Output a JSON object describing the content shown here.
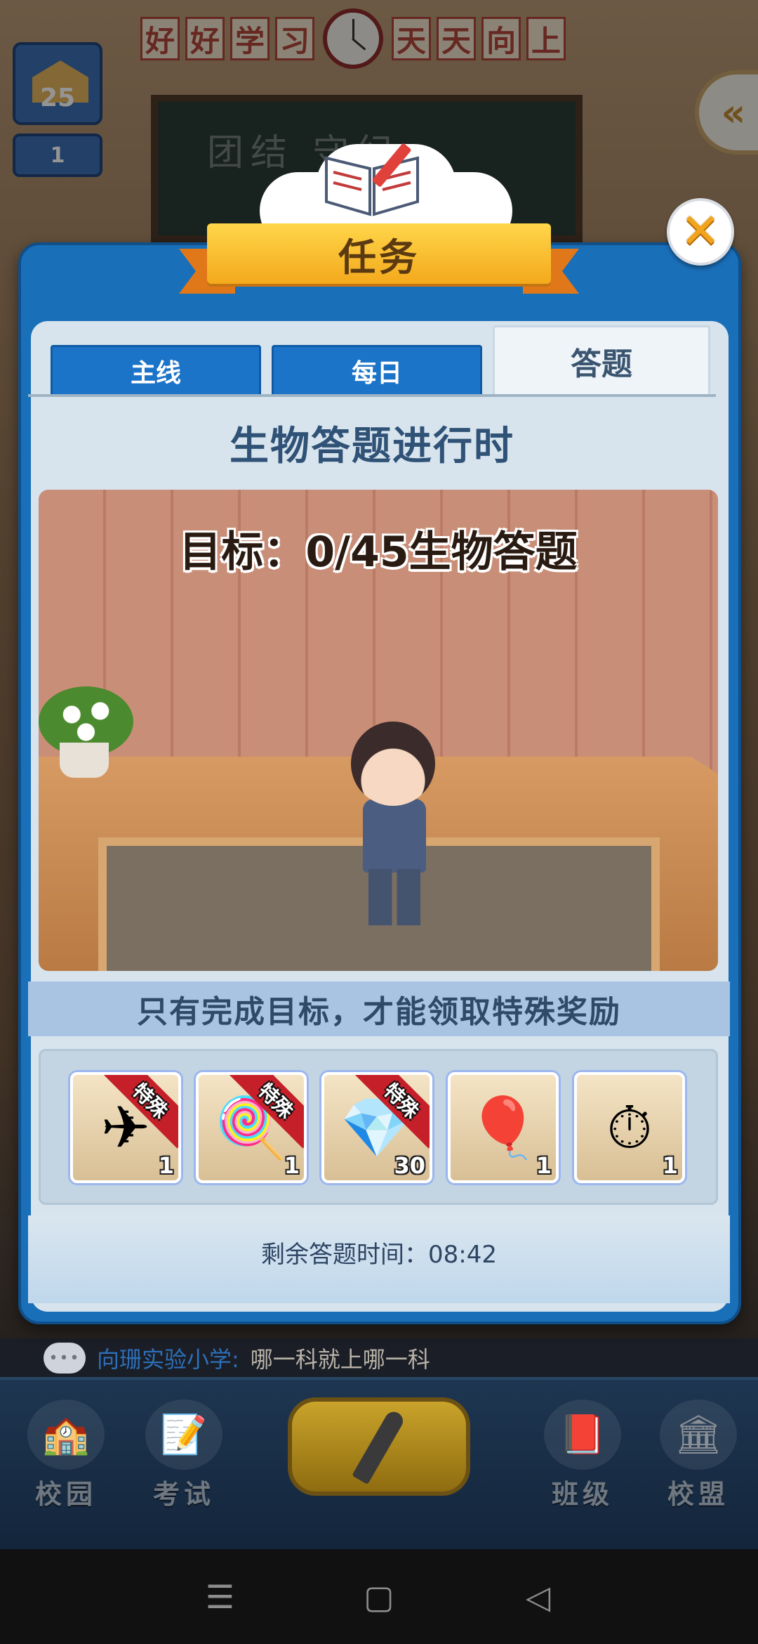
{
  "background": {
    "slogan_chars_left": [
      "好",
      "好",
      "学",
      "习"
    ],
    "slogan_chars_right": [
      "天",
      "天",
      "向",
      "上"
    ],
    "blackboard_text": "团结 守纪",
    "level_value": "25",
    "rank_value": "1",
    "side_arrow_glyph": "«"
  },
  "dialog": {
    "title": "任务",
    "close_glyph": "✕",
    "tabs": [
      {
        "label": "主线",
        "active": false
      },
      {
        "label": "每日",
        "active": false
      },
      {
        "label": "答题",
        "active": true
      }
    ],
    "quiz_title": "生物答题进行时",
    "goal_text": "目标：0/45生物答题",
    "hint_text": "只有完成目标，才能领取特殊奖励",
    "rewards": [
      {
        "icon": "paper-plane-icon",
        "glyph": "✈",
        "count": "1",
        "special": true,
        "special_label": "特殊"
      },
      {
        "icon": "lollipop-icon",
        "glyph": "🍭",
        "count": "1",
        "special": true,
        "special_label": "特殊"
      },
      {
        "icon": "purple-diamond-icon",
        "glyph": "💎",
        "count": "30",
        "special": true,
        "special_label": "特殊"
      },
      {
        "icon": "green-balloon-icon",
        "glyph": "🎈",
        "count": "1",
        "special": false
      },
      {
        "icon": "stopwatch-icon",
        "glyph": "⏱",
        "count": "1",
        "special": false
      }
    ],
    "timer_text": "剩余答题时间：08:42"
  },
  "chat": {
    "icon_text": "•••",
    "school": "向珊实验小学:",
    "message": "哪一科就上哪一科"
  },
  "bottom_nav": [
    {
      "label": "校园",
      "icon": "campus-icon",
      "glyph": "🏫"
    },
    {
      "label": "考试",
      "icon": "exam-icon",
      "glyph": "📝"
    },
    {
      "label": "班级",
      "icon": "class-icon",
      "glyph": "📕"
    },
    {
      "label": "校盟",
      "icon": "alliance-icon",
      "glyph": "🏛"
    }
  ],
  "system_nav": {
    "menu_glyph": "☰",
    "home_glyph": "▢",
    "back_glyph": "◁"
  },
  "colors": {
    "dialog_frame": "#1a6fb9",
    "tab_inactive": "#1c74c9",
    "title_text": "#2f5276",
    "special_ribbon": "#c5202a",
    "ribbon_gold": "#f4a91c"
  }
}
